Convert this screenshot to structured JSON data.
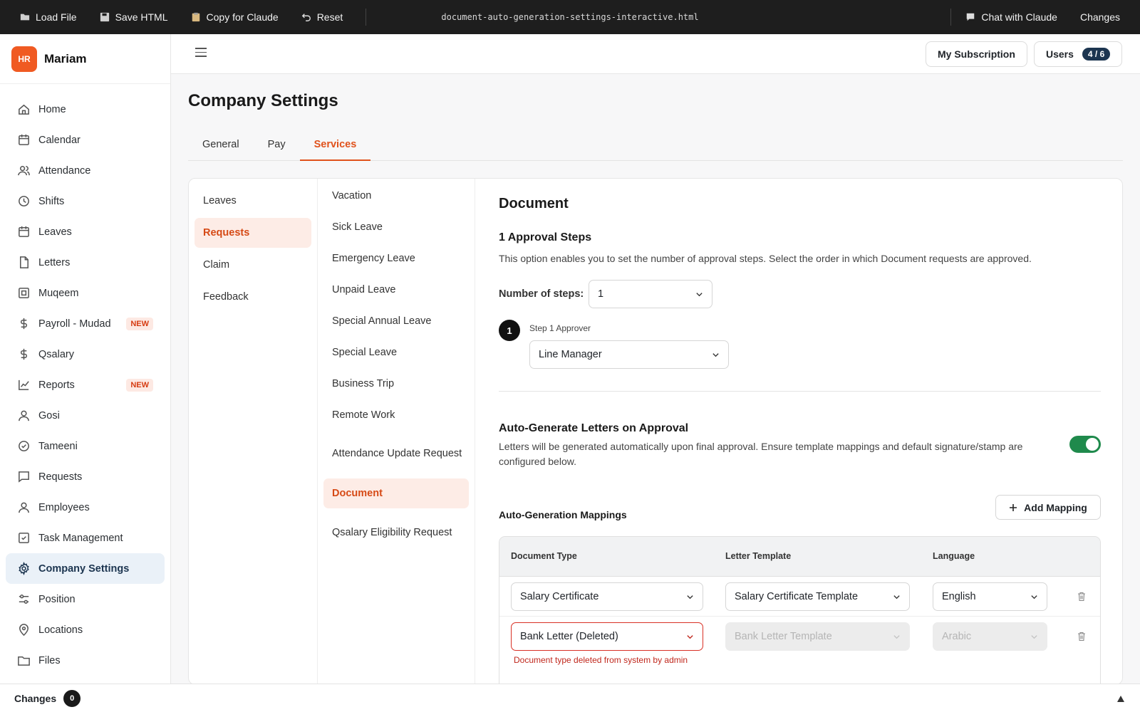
{
  "topbar": {
    "load_file": "Load File",
    "save_html": "Save HTML",
    "copy_for_claude": "Copy for Claude",
    "reset": "Reset",
    "filename": "document-auto-generation-settings-interactive.html",
    "chat_with_claude": "Chat with Claude",
    "changes": "Changes"
  },
  "brand": {
    "logo": "HR",
    "name": "Mariam",
    "logo_color": "#f05a22"
  },
  "sidebar": {
    "items": [
      {
        "label": "Home",
        "icon": "home-icon"
      },
      {
        "label": "Calendar",
        "icon": "calendar-icon"
      },
      {
        "label": "Attendance",
        "icon": "users-icon"
      },
      {
        "label": "Shifts",
        "icon": "clock-icon"
      },
      {
        "label": "Leaves",
        "icon": "calendar-icon"
      },
      {
        "label": "Letters",
        "icon": "file-icon"
      },
      {
        "label": "Muqeem",
        "icon": "id-icon"
      },
      {
        "label": "Payroll - Mudad",
        "icon": "dollar-icon",
        "badge": "NEW"
      },
      {
        "label": "Qsalary",
        "icon": "dollar-icon"
      },
      {
        "label": "Reports",
        "icon": "chart-icon",
        "badge": "NEW"
      },
      {
        "label": "Gosi",
        "icon": "user-icon"
      },
      {
        "label": "Tameeni",
        "icon": "check-circle-icon"
      },
      {
        "label": "Requests",
        "icon": "message-icon"
      },
      {
        "label": "Employees",
        "icon": "user-icon"
      },
      {
        "label": "Task Management",
        "icon": "check-square-icon"
      },
      {
        "label": "Company Settings",
        "icon": "gear-icon",
        "active": true
      },
      {
        "label": "Position",
        "icon": "sliders-icon"
      },
      {
        "label": "Locations",
        "icon": "pin-icon"
      },
      {
        "label": "Files",
        "icon": "folder-icon"
      }
    ]
  },
  "header": {
    "subscription": "My Subscription",
    "users_label": "Users",
    "users_count": "4 / 6"
  },
  "page": {
    "title": "Company Settings",
    "tabs": [
      "General",
      "Pay",
      "Services"
    ],
    "active_tab": "Services"
  },
  "services": {
    "categories": [
      "Leaves",
      "Requests",
      "Claim",
      "Feedback"
    ],
    "active_category": "Requests",
    "request_types": [
      "Vacation",
      "Sick Leave",
      "Emergency Leave",
      "Unpaid Leave",
      "Special Annual Leave",
      "Special Leave",
      "Business Trip",
      "Remote Work",
      "Attendance Update Request",
      "Document",
      "Qsalary Eligibility Request"
    ],
    "active_request_type": "Document"
  },
  "detail": {
    "title": "Document",
    "approval_title": "1 Approval Steps",
    "approval_desc": "This option enables you to set the number of approval steps. Select the order in which Document requests are approved.",
    "steps_label": "Number of steps:",
    "steps_value": "1",
    "step_number": "1",
    "step_label": "Step 1 Approver",
    "step_approver": "Line Manager",
    "auto_title": "Auto-Generate Letters on Approval",
    "auto_desc": "Letters will be generated automatically upon final approval. Ensure template mappings and default signature/stamp are configured below.",
    "auto_enabled": true,
    "mappings_title": "Auto-Generation Mappings",
    "add_mapping": "Add Mapping",
    "columns": [
      "Document Type",
      "Letter Template",
      "Language"
    ],
    "rows": [
      {
        "document_type": "Salary Certificate",
        "template": "Salary Certificate Template",
        "language": "English"
      },
      {
        "document_type": "Bank Letter (Deleted)",
        "template": "Bank Letter Template",
        "language": "Arabic",
        "error": "Document type deleted from system by admin"
      }
    ]
  },
  "bottombar": {
    "label": "Changes",
    "count": "0"
  }
}
